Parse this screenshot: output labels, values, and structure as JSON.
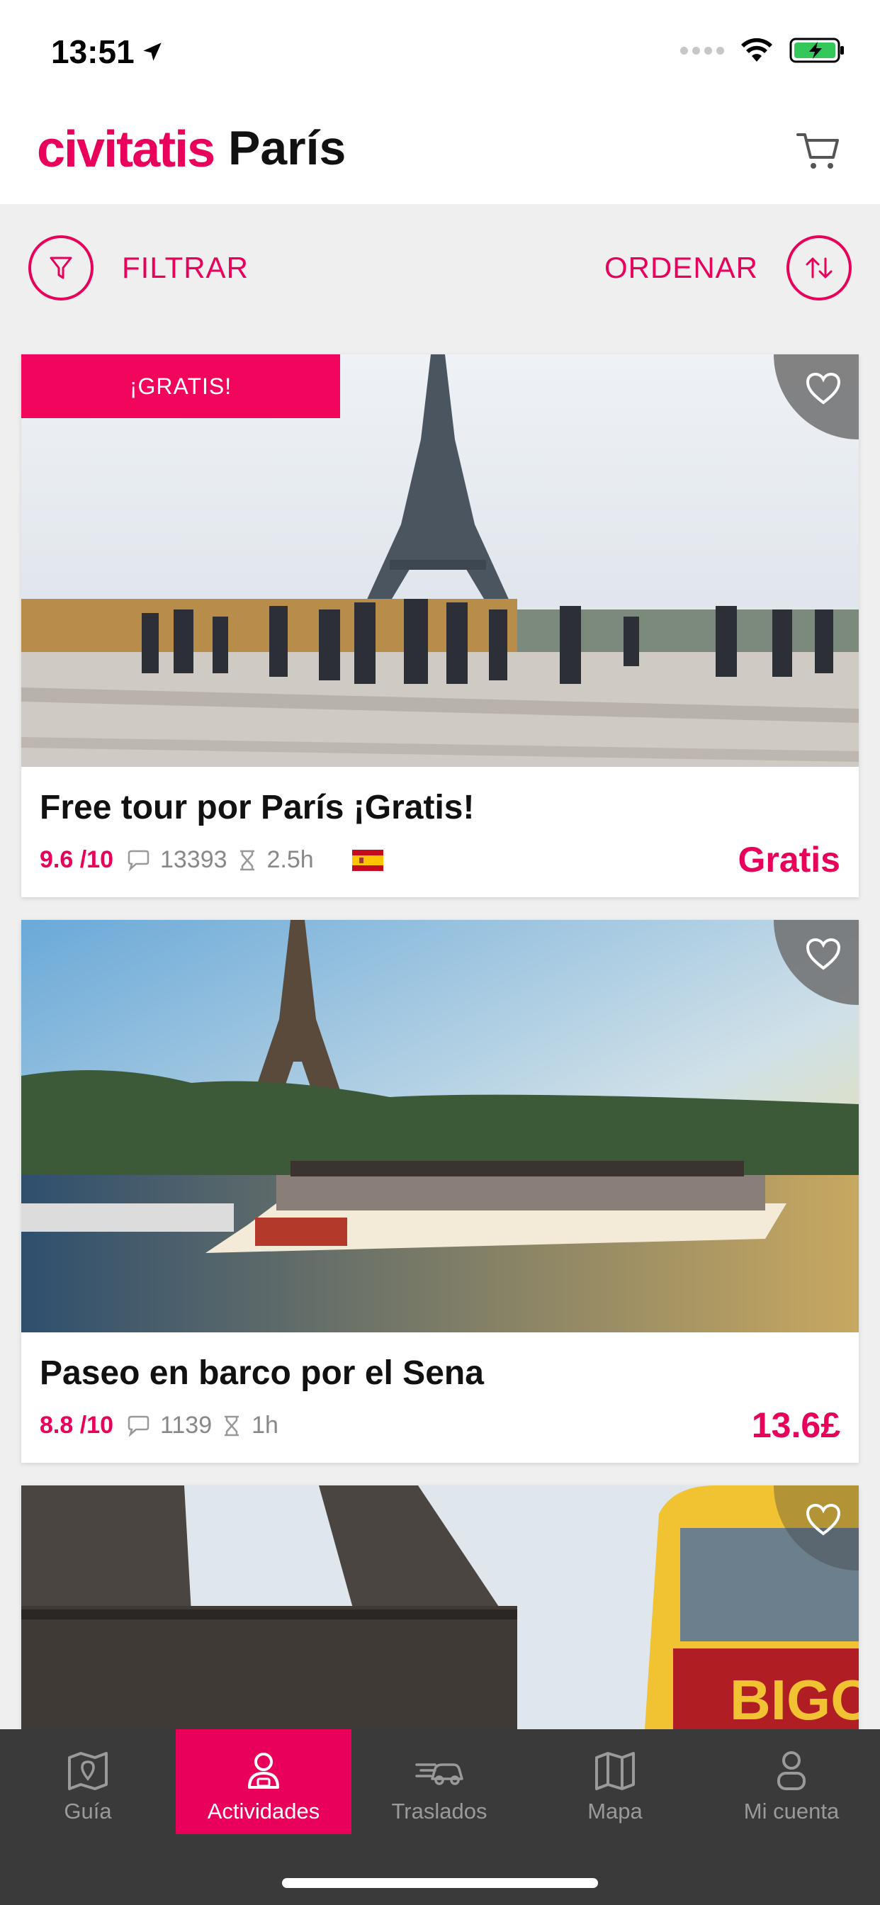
{
  "status_bar": {
    "time": "13:51",
    "location_icon": "location-arrow-icon",
    "wifi_icon": "wifi-icon",
    "battery_icon": "battery-charging-icon"
  },
  "header": {
    "brand": "civitatis",
    "city": "París",
    "cart_icon": "cart-icon"
  },
  "toolbar": {
    "filter_label": "FILTRAR",
    "sort_label": "ORDENAR",
    "filter_icon": "filter-icon",
    "sort_icon": "sort-icon"
  },
  "activities": [
    {
      "badge": "¡GRATIS!",
      "title": "Free tour por París ¡Gratis!",
      "rating": "9.6 /10",
      "reviews": "13393",
      "duration": "2.5h",
      "language_flag": "spain-flag-icon",
      "price": "Gratis"
    },
    {
      "title": "Paseo en barco por el Sena",
      "rating": "8.8 /10",
      "reviews": "1139",
      "duration": "1h",
      "price": "13.6£"
    },
    {
      "image_text": "BIGO"
    }
  ],
  "tabs": [
    {
      "label": "Guía",
      "icon": "map-pin-icon"
    },
    {
      "label": "Actividades",
      "icon": "guide-icon"
    },
    {
      "label": "Traslados",
      "icon": "car-icon"
    },
    {
      "label": "Mapa",
      "icon": "map-icon"
    },
    {
      "label": "Mi cuenta",
      "icon": "user-icon"
    }
  ],
  "colors": {
    "accent": "#e8005a",
    "tab_bar": "#3a3a3a",
    "background": "#efefef"
  }
}
